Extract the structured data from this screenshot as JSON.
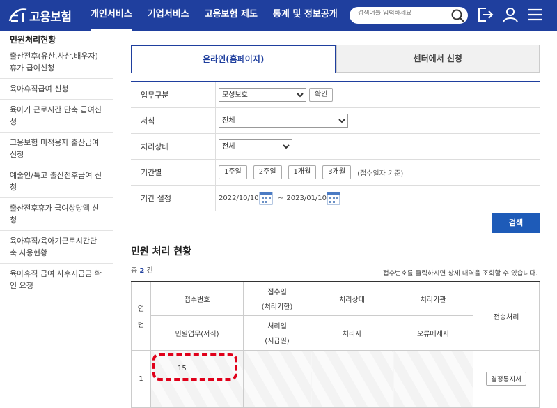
{
  "header": {
    "logo_text": "고용보험",
    "nav": [
      "개인서비스",
      "기업서비스",
      "고용보험 제도",
      "통계 및 정보공개"
    ],
    "search_placeholder": "검색어를 입력하세요"
  },
  "sidebar": {
    "title": "민원처리현황",
    "items": [
      "출산전후(유산.사산.배우자)휴가 급여신청",
      "육아휴직급여 신청",
      "육아기 근로시간 단축 급여신청",
      "고용보험 미적용자 출산급여 신청",
      "예술인/특고 출산전후급여 신청",
      "출산전후휴가 급여상당액 신청",
      "육아휴직/육아기근로시간단축 사용현황",
      "육아휴직 급여 사후지급금 확인 요청"
    ]
  },
  "tabs": [
    "온라인(홈페이지)",
    "센터에서 신청"
  ],
  "form": {
    "work_type_label": "업무구분",
    "work_type_value": "모성보호",
    "confirm_label": "확인",
    "form_label": "서식",
    "form_value": "전체",
    "status_label": "처리상태",
    "status_value": "전체",
    "period_label": "기간별",
    "period_buttons": [
      "1주일",
      "2주일",
      "1개월",
      "3개월"
    ],
    "period_hint": "(접수일자 기준)",
    "date_label": "기간 설정",
    "date_from": "2022/10/10",
    "date_sep": "~",
    "date_to": "2023/01/10",
    "search_button": "검색"
  },
  "results": {
    "title": "민원 처리 현황",
    "count_prefix": "총",
    "count": "2",
    "count_suffix": "건",
    "note": "접수번호를 클릭하시면 상세 내역을 조회할 수 있습니다.",
    "headers": {
      "no_1": "연",
      "no_2": "번",
      "receipt_no": "접수번호",
      "receipt_date_1": "접수일",
      "receipt_date_2": "(처리기한)",
      "status": "처리상태",
      "agency": "처리기관",
      "electronic": "전송처리",
      "task": "민원업무(서식)",
      "processed_1": "처리일",
      "processed_2": "(지급일)",
      "handler": "처리자",
      "error": "오류메세지"
    },
    "row": {
      "no": "1",
      "receipt_no": "15",
      "doc_button": "결정통지서"
    }
  }
}
